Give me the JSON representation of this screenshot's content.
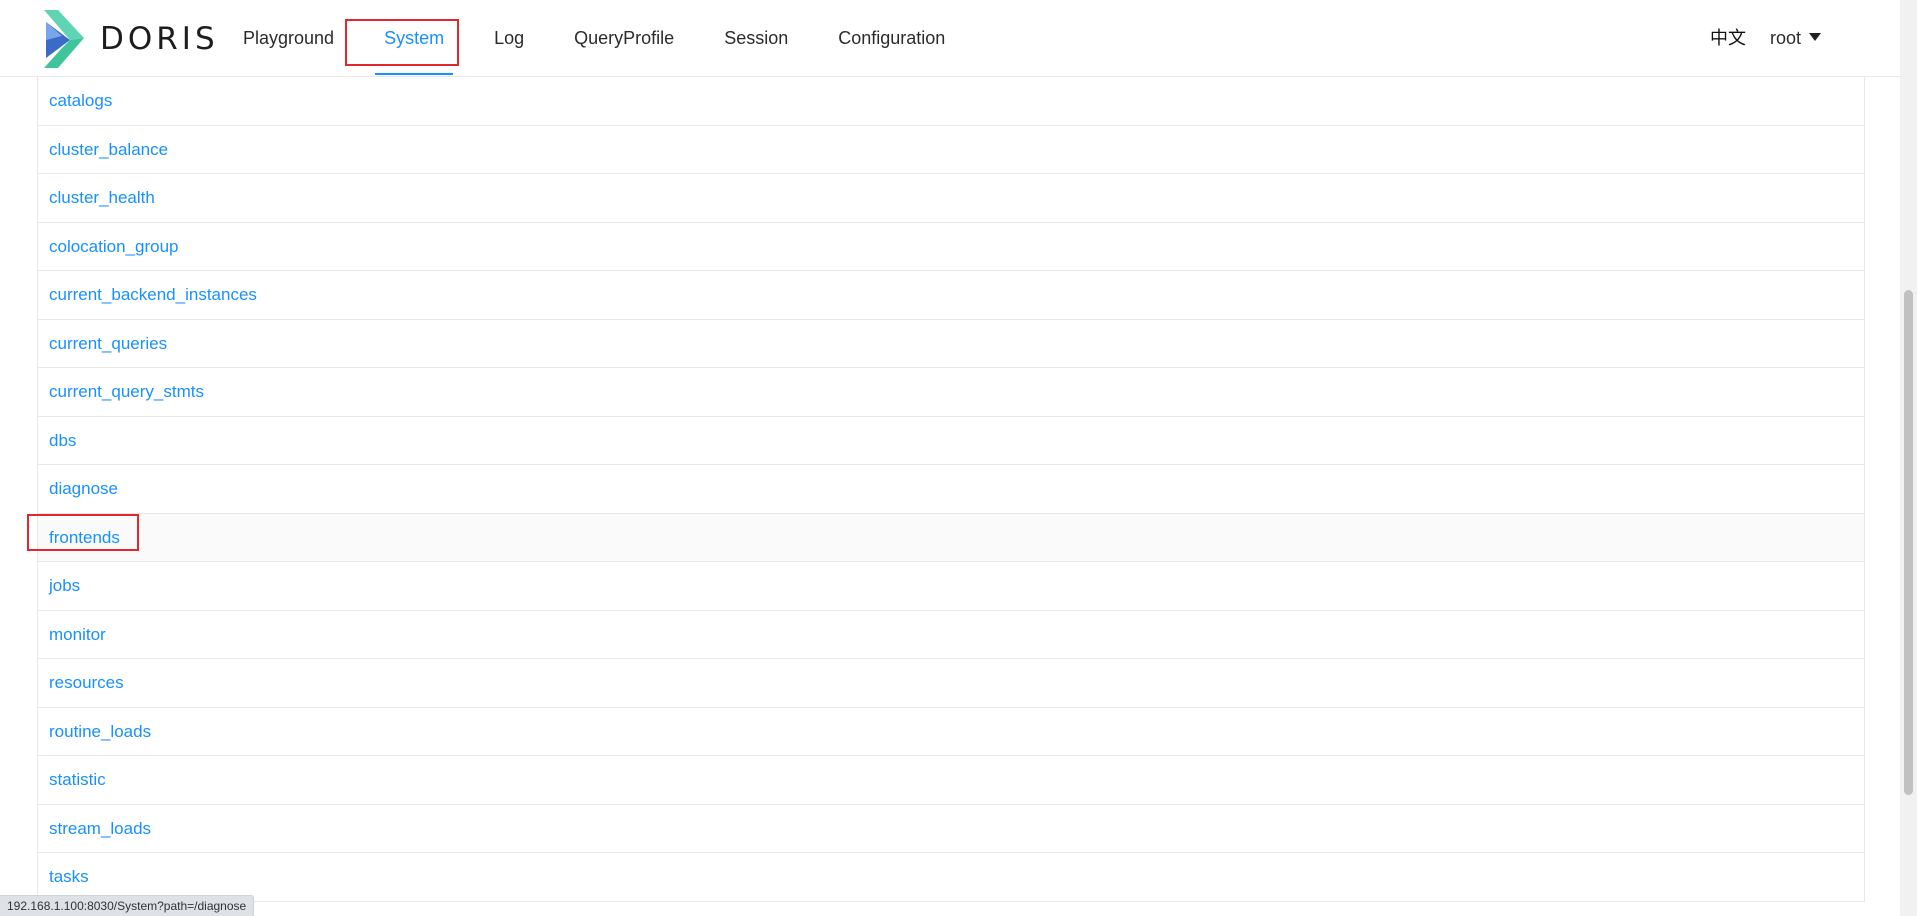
{
  "header": {
    "brand": "DORIS",
    "nav": [
      "Playground",
      "System",
      "Log",
      "QueryProfile",
      "Session",
      "Configuration"
    ],
    "active_nav": "System",
    "language": "中文",
    "user": "root"
  },
  "colors": {
    "accent": "#1890ff",
    "highlight_box": "#e0282e",
    "logo_blue": "#3b6bc6",
    "logo_green": "#3fc49b"
  },
  "icons": [
    "doris-logo-icon",
    "caret-down-icon"
  ],
  "list": {
    "items": [
      "catalogs",
      "cluster_balance",
      "cluster_health",
      "colocation_group",
      "current_backend_instances",
      "current_queries",
      "current_query_stmts",
      "dbs",
      "diagnose",
      "frontends",
      "jobs",
      "monitor",
      "resources",
      "routine_loads",
      "statistic",
      "stream_loads",
      "tasks"
    ],
    "hovered": "frontends"
  },
  "status_bar": {
    "url": "192.168.1.100:8030/System?path=/diagnose"
  }
}
